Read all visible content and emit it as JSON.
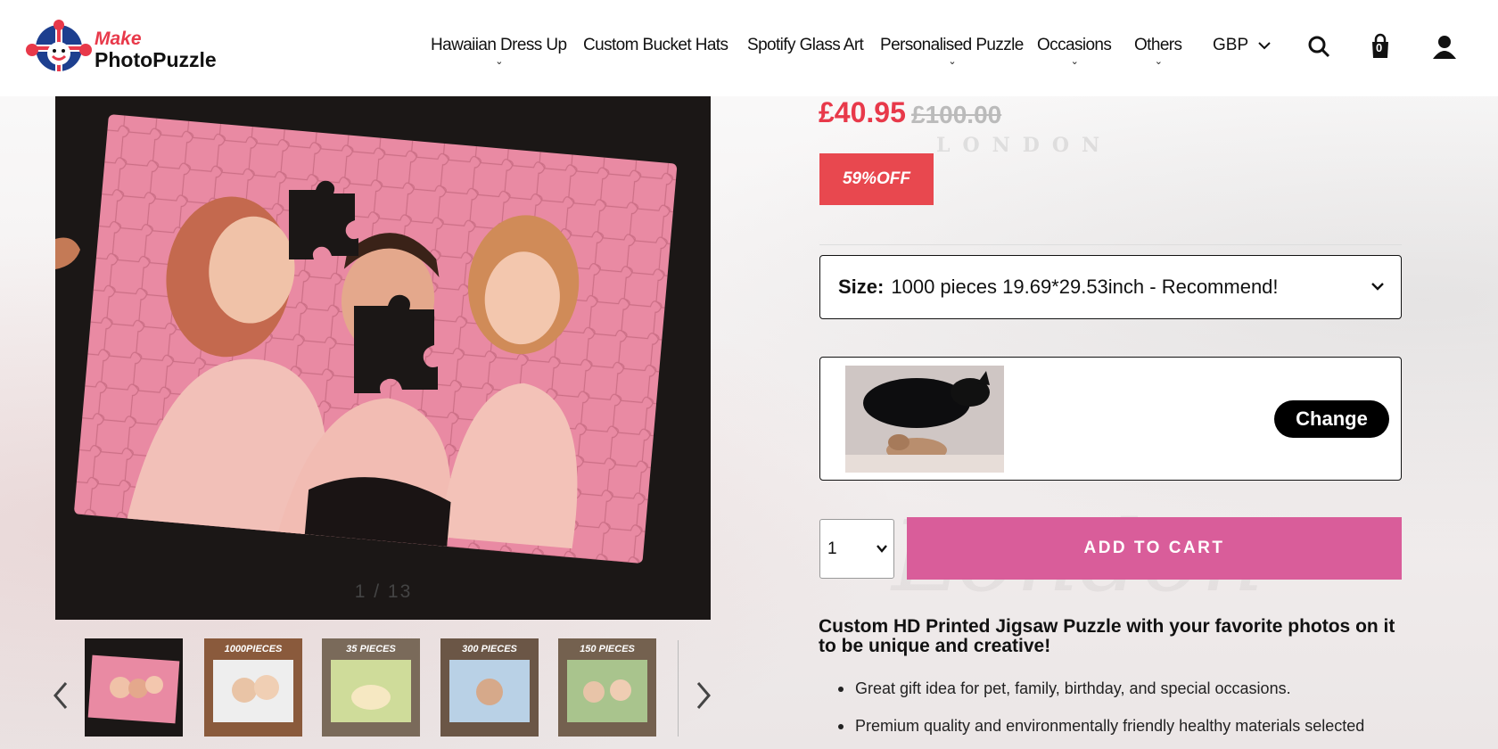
{
  "brand": {
    "line1": "Make",
    "line2": "PhotoPuzzle"
  },
  "nav": [
    {
      "label": "Hawaiian Dress Up",
      "dropdown": true
    },
    {
      "label": "Custom Bucket Hats",
      "dropdown": false
    },
    {
      "label": "Spotify Glass Art",
      "dropdown": false
    },
    {
      "label": "Personalised Puzzle",
      "dropdown": true
    },
    {
      "label": "Occasions",
      "dropdown": true
    },
    {
      "label": "Others",
      "dropdown": true
    }
  ],
  "currency": "GBP",
  "cart_count": "0",
  "gallery": {
    "counter": "1 / 13",
    "thumbs": [
      "",
      "1000PIECES",
      "35 PIECES",
      "300 PIECES",
      "150 PIECES"
    ]
  },
  "product": {
    "price": "£40.95",
    "old_price": "£100.00",
    "discount": "59%OFF",
    "size_label": "Size:",
    "size_value": "1000 pieces 19.69*29.53inch - Recommend!",
    "change_label": "Change",
    "quantity": "1",
    "add_to_cart": "ADD TO CART"
  },
  "description": {
    "title": "Custom HD Printed Jigsaw Puzzle with your favorite photos on it to be unique and creative!",
    "bullets": [
      "Great gift idea for pet, family, birthday, and special occasions.",
      "Premium quality and environmentally friendly healthy materials selected"
    ]
  },
  "colors": {
    "accent_red": "#e8394a",
    "cart_pink": "#d95d9a",
    "badge_red": "#e8484f"
  },
  "icons": [
    "search-icon",
    "bag-icon",
    "user-icon",
    "chevron-down-icon",
    "chevron-left-icon",
    "chevron-right-icon"
  ]
}
